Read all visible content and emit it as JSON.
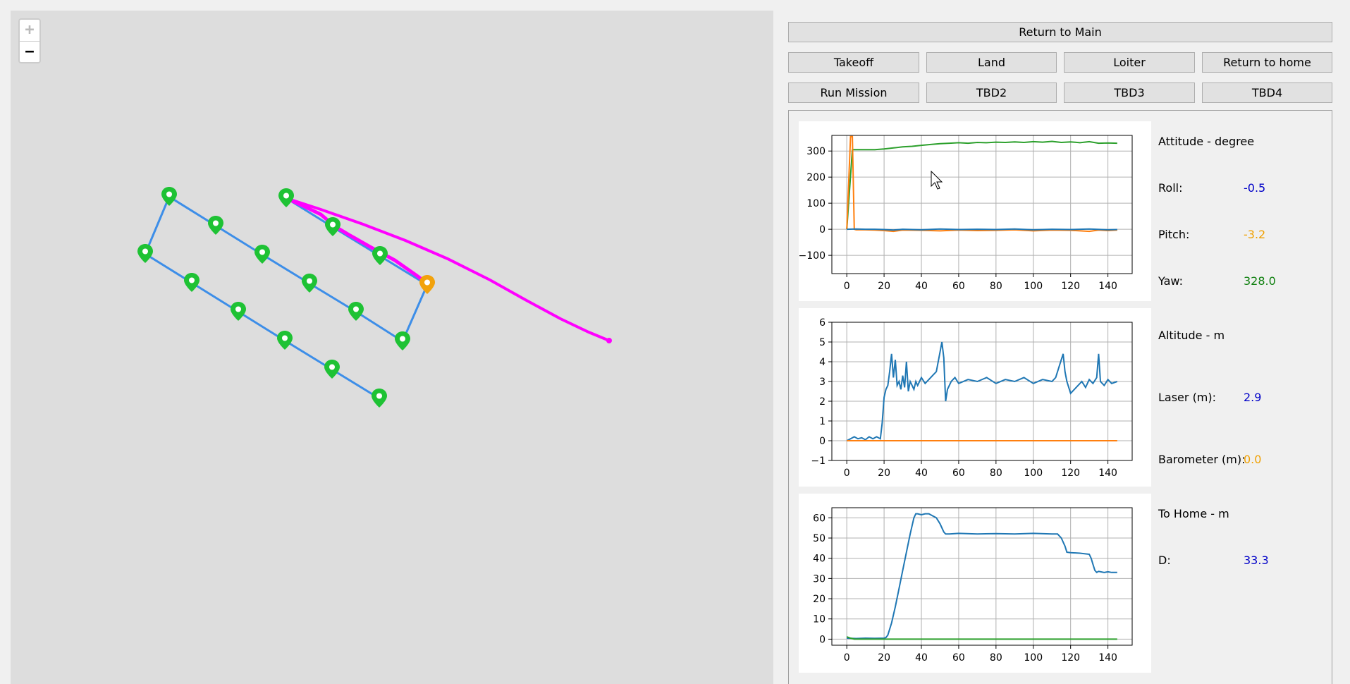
{
  "map": {
    "zoom_in": "+",
    "zoom_out": "−",
    "colors": {
      "route": "#3d8ee8",
      "track": "#ff00ff",
      "waypoint": "#1ec234",
      "current": "#f2a20c"
    },
    "waypoints": [
      [
        225,
        264
      ],
      [
        291,
        305
      ],
      [
        357,
        346
      ],
      [
        424,
        387
      ],
      [
        490,
        427
      ],
      [
        191,
        345
      ],
      [
        257,
        386
      ],
      [
        323,
        427
      ],
      [
        389,
        468
      ],
      [
        456,
        509
      ],
      [
        523,
        550
      ],
      [
        391,
        266
      ],
      [
        457,
        307
      ],
      [
        524,
        348
      ],
      [
        556,
        469
      ]
    ],
    "route": [
      [
        556,
        469
      ],
      [
        490,
        427
      ],
      [
        424,
        387
      ],
      [
        357,
        346
      ],
      [
        291,
        305
      ],
      [
        225,
        264
      ],
      [
        191,
        345
      ],
      [
        257,
        386
      ],
      [
        323,
        427
      ],
      [
        389,
        468
      ],
      [
        456,
        509
      ],
      [
        523,
        550
      ]
    ],
    "current_waypoint": [
      591,
      389
    ],
    "track": [
      [
        391,
        266
      ],
      [
        415,
        277
      ],
      [
        440,
        289
      ],
      [
        460,
        306
      ],
      [
        480,
        318
      ],
      [
        510,
        335
      ],
      [
        545,
        354
      ],
      [
        575,
        375
      ],
      [
        590,
        386
      ],
      [
        591,
        389
      ]
    ],
    "track2": [
      [
        391,
        266
      ],
      [
        440,
        282
      ],
      [
        500,
        303
      ],
      [
        560,
        326
      ],
      [
        620,
        352
      ],
      [
        680,
        382
      ],
      [
        730,
        410
      ],
      [
        780,
        437
      ],
      [
        820,
        456
      ],
      [
        849,
        468
      ]
    ]
  },
  "buttons": {
    "return_main": "Return to Main",
    "takeoff": "Takeoff",
    "land": "Land",
    "loiter": "Loiter",
    "return_home": "Return to home",
    "run_mission": "Run Mission",
    "tbd2": "TBD2",
    "tbd3": "TBD3",
    "tbd4": "TBD4"
  },
  "telemetry": {
    "attitude_title": "Attitude - degree",
    "roll_label": "Roll:",
    "roll_value": "-0.5",
    "pitch_label": "Pitch:",
    "pitch_value": "-3.2",
    "yaw_label": "Yaw:",
    "yaw_value": "328.0",
    "altitude_title": "Altitude - m",
    "laser_label": "Laser (m):",
    "laser_value": "2.9",
    "baro_label": "Barometer (m):",
    "baro_value": "0.0",
    "home_title": "To Home - m",
    "d_label": "D:",
    "d_value": "33.3",
    "colors": {
      "roll": "#0000c8",
      "pitch": "#f0a000",
      "yaw": "#108010"
    }
  },
  "chart_data": [
    {
      "type": "line",
      "xlim": [
        -8,
        153
      ],
      "ylim": [
        -170,
        360
      ],
      "xticks": [
        0,
        20,
        40,
        60,
        80,
        100,
        120,
        140
      ],
      "yticks": [
        -100,
        0,
        100,
        200,
        300
      ],
      "series": [
        {
          "color": "#2ca02c",
          "x": [
            0,
            3,
            5,
            10,
            15,
            20,
            25,
            30,
            35,
            40,
            45,
            50,
            55,
            60,
            65,
            70,
            75,
            80,
            85,
            90,
            95,
            100,
            105,
            110,
            115,
            120,
            125,
            130,
            135,
            140,
            145
          ],
          "y": [
            0,
            305,
            305,
            305,
            305,
            308,
            312,
            316,
            318,
            322,
            325,
            328,
            330,
            332,
            330,
            333,
            332,
            334,
            333,
            335,
            333,
            336,
            334,
            337,
            333,
            335,
            332,
            336,
            330,
            331,
            330
          ]
        },
        {
          "color": "#ff7f0e",
          "x": [
            0,
            2,
            3,
            4,
            5,
            10,
            15,
            20,
            25,
            30,
            40,
            50,
            60,
            70,
            80,
            90,
            100,
            110,
            120,
            130,
            135,
            140,
            145
          ],
          "y": [
            0,
            355,
            355,
            0,
            -2,
            -2,
            -3,
            -5,
            -8,
            -3,
            -4,
            -6,
            -3,
            -5,
            -4,
            -2,
            -6,
            -3,
            -4,
            -8,
            -3,
            -5,
            -3
          ]
        },
        {
          "color": "#1f77b4",
          "x": [
            0,
            5,
            10,
            15,
            20,
            25,
            30,
            40,
            50,
            60,
            70,
            80,
            90,
            100,
            110,
            120,
            130,
            140,
            145
          ],
          "y": [
            0,
            1,
            0,
            0,
            -1,
            -3,
            0,
            -2,
            1,
            -1,
            0,
            -1,
            1,
            -2,
            0,
            -1,
            1,
            -2,
            -1
          ]
        }
      ]
    },
    {
      "type": "line",
      "xlim": [
        -8,
        153
      ],
      "ylim": [
        -1,
        6
      ],
      "xticks": [
        0,
        20,
        40,
        60,
        80,
        100,
        120,
        140
      ],
      "yticks": [
        -1,
        0,
        1,
        2,
        3,
        4,
        5,
        6
      ],
      "series": [
        {
          "color": "#1f77b4",
          "x": [
            0,
            2,
            4,
            6,
            8,
            10,
            12,
            14,
            16,
            18,
            19,
            20,
            21,
            22,
            23,
            24,
            25,
            26,
            27,
            28,
            29,
            30,
            31,
            32,
            33,
            34,
            35,
            36,
            37,
            38,
            40,
            42,
            44,
            46,
            48,
            50,
            51,
            52,
            53,
            54,
            56,
            58,
            60,
            65,
            70,
            75,
            80,
            85,
            90,
            95,
            100,
            105,
            110,
            112,
            114,
            116,
            117,
            118,
            120,
            122,
            124,
            126,
            128,
            130,
            132,
            134,
            135,
            136,
            138,
            140,
            142,
            145
          ],
          "y": [
            0,
            0.1,
            0.2,
            0.1,
            0.15,
            0.05,
            0.2,
            0.1,
            0.2,
            0.1,
            0.9,
            2.2,
            2.6,
            2.8,
            3.5,
            4.4,
            3.2,
            4.1,
            2.8,
            3.0,
            2.6,
            3.3,
            2.7,
            4.0,
            2.5,
            3.0,
            2.8,
            2.6,
            3.0,
            2.8,
            3.2,
            2.9,
            3.1,
            3.3,
            3.5,
            4.5,
            5.0,
            4.2,
            2.0,
            2.6,
            3.0,
            3.2,
            2.9,
            3.1,
            3.0,
            3.2,
            2.9,
            3.1,
            3.0,
            3.2,
            2.9,
            3.1,
            3.0,
            3.2,
            3.8,
            4.4,
            3.5,
            3.0,
            2.4,
            2.6,
            2.8,
            3.0,
            2.7,
            3.1,
            2.9,
            3.2,
            4.4,
            3.0,
            2.8,
            3.1,
            2.9,
            3.0
          ]
        },
        {
          "color": "#ff7f0e",
          "x": [
            0,
            145
          ],
          "y": [
            0,
            0
          ]
        }
      ]
    },
    {
      "type": "line",
      "xlim": [
        -8,
        153
      ],
      "ylim": [
        -3,
        65
      ],
      "xticks": [
        0,
        20,
        40,
        60,
        80,
        100,
        120,
        140
      ],
      "yticks": [
        0,
        10,
        20,
        30,
        40,
        50,
        60
      ],
      "series": [
        {
          "color": "#1f77b4",
          "x": [
            0,
            5,
            10,
            15,
            20,
            21,
            22,
            24,
            26,
            28,
            30,
            32,
            34,
            36,
            37,
            38,
            40,
            42,
            44,
            46,
            48,
            50,
            52,
            53,
            55,
            60,
            70,
            80,
            90,
            100,
            110,
            113,
            115,
            117,
            118,
            120,
            125,
            130,
            131,
            132,
            133,
            134,
            135,
            138,
            140,
            142,
            145
          ],
          "y": [
            0.5,
            0.3,
            0.5,
            0.4,
            0.5,
            0.8,
            2,
            8,
            16,
            25,
            34,
            43,
            52,
            60,
            62,
            62,
            61.5,
            62,
            62,
            61,
            60,
            57,
            53,
            52,
            52,
            52.3,
            52,
            52.2,
            52,
            52.3,
            52,
            52,
            50,
            46,
            43,
            42.8,
            42.5,
            42,
            40,
            37,
            34,
            33,
            33.5,
            33,
            33.3,
            33,
            33
          ]
        },
        {
          "color": "#2ca02c",
          "x": [
            0,
            2,
            4,
            145
          ],
          "y": [
            1.2,
            0.5,
            0,
            0
          ]
        }
      ]
    }
  ]
}
